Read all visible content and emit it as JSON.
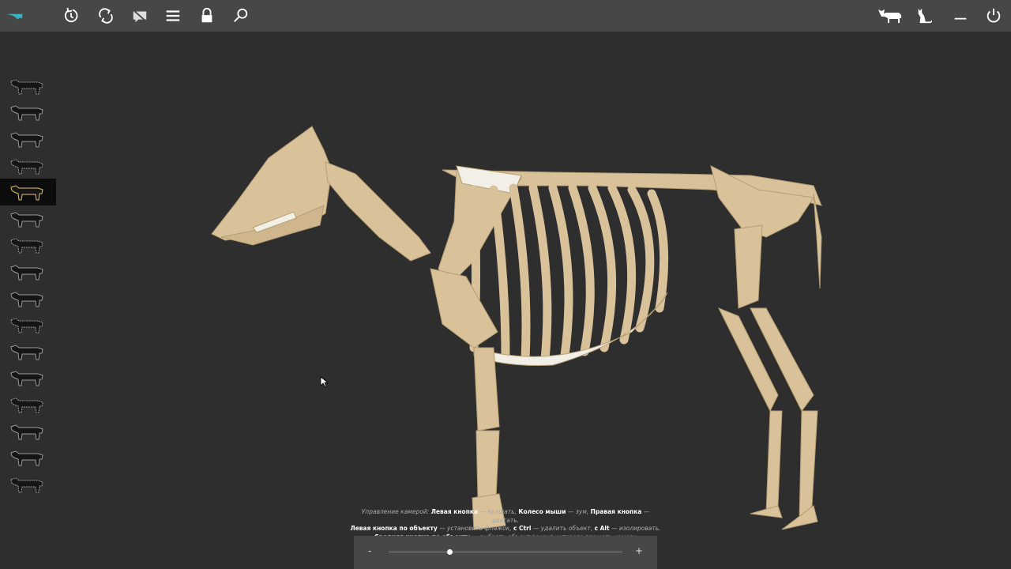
{
  "toolbar": {
    "left": [
      {
        "icon": "logo-icon"
      },
      {
        "icon": "reset-view-icon"
      },
      {
        "icon": "rotate-icon"
      },
      {
        "icon": "hide-labels-icon"
      },
      {
        "icon": "menu-icon"
      },
      {
        "icon": "lock-icon"
      },
      {
        "icon": "search-icon"
      }
    ],
    "right": [
      {
        "icon": "cow-icon"
      },
      {
        "icon": "cat-icon"
      },
      {
        "icon": "minimize-icon"
      },
      {
        "icon": "power-icon"
      }
    ]
  },
  "sidebar": {
    "active_index": 4,
    "count": 16,
    "accent": "#e8c060"
  },
  "help": {
    "l1_a": "Управление камерой:",
    "l1_b": "Левая кнопка",
    "l1_c": "— вращать,",
    "l1_d": "Колесо мыши",
    "l1_e": "— зум,",
    "l1_f": "Правая кнопка",
    "l1_g": "— двигать.",
    "l2_a": "Левая кнопка по объекту",
    "l2_b": "— установить флажок,",
    "l2_c": "с Ctrl",
    "l2_d": "— удалить объект,",
    "l2_e": "с Alt",
    "l2_f": "— изолировать.",
    "l3_a": "Средняя кнопка по объекту",
    "l3_b": "— выбрать объект вокруг которого вращать камеру"
  },
  "zoom": {
    "minus": "-",
    "plus": "+",
    "value": 0.26
  },
  "colors": {
    "bone": "#d9c29a",
    "cartilage": "#f2efe6",
    "bg": "#2e2e2e",
    "bar": "#474747"
  }
}
